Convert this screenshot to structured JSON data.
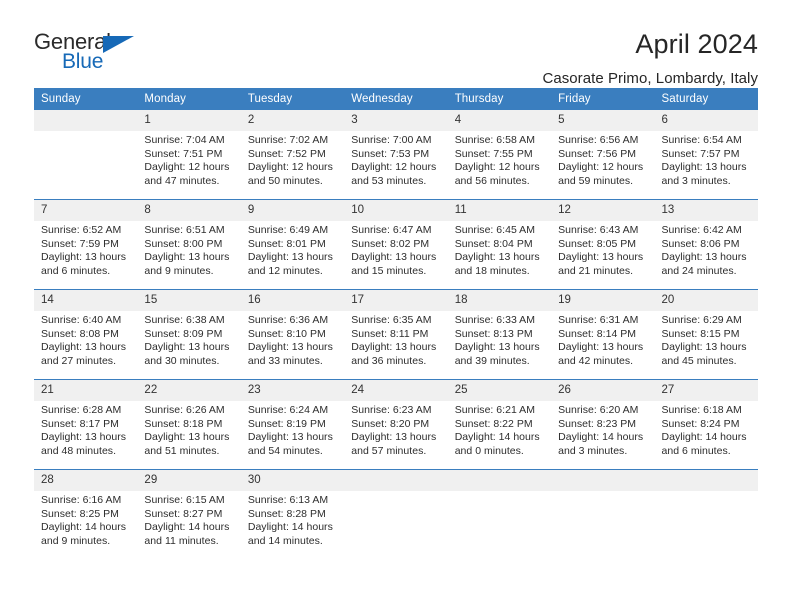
{
  "brand": {
    "word_one": "General",
    "word_two": "Blue",
    "accent_color": "#1669b7",
    "triangle_icon": "triangle-icon"
  },
  "header": {
    "title": "April 2024",
    "subtitle": "Casorate Primo, Lombardy, Italy"
  },
  "calendar": {
    "header_color": "#3a7ebf",
    "day_band_color": "#f0f0f0",
    "weekdays": [
      "Sunday",
      "Monday",
      "Tuesday",
      "Wednesday",
      "Thursday",
      "Friday",
      "Saturday"
    ],
    "weeks": [
      [
        {
          "day": ""
        },
        {
          "day": "1",
          "sunrise": "Sunrise: 7:04 AM",
          "sunset": "Sunset: 7:51 PM",
          "daylight_1": "Daylight: 12 hours",
          "daylight_2": "and 47 minutes."
        },
        {
          "day": "2",
          "sunrise": "Sunrise: 7:02 AM",
          "sunset": "Sunset: 7:52 PM",
          "daylight_1": "Daylight: 12 hours",
          "daylight_2": "and 50 minutes."
        },
        {
          "day": "3",
          "sunrise": "Sunrise: 7:00 AM",
          "sunset": "Sunset: 7:53 PM",
          "daylight_1": "Daylight: 12 hours",
          "daylight_2": "and 53 minutes."
        },
        {
          "day": "4",
          "sunrise": "Sunrise: 6:58 AM",
          "sunset": "Sunset: 7:55 PM",
          "daylight_1": "Daylight: 12 hours",
          "daylight_2": "and 56 minutes."
        },
        {
          "day": "5",
          "sunrise": "Sunrise: 6:56 AM",
          "sunset": "Sunset: 7:56 PM",
          "daylight_1": "Daylight: 12 hours",
          "daylight_2": "and 59 minutes."
        },
        {
          "day": "6",
          "sunrise": "Sunrise: 6:54 AM",
          "sunset": "Sunset: 7:57 PM",
          "daylight_1": "Daylight: 13 hours",
          "daylight_2": "and 3 minutes."
        }
      ],
      [
        {
          "day": "7",
          "sunrise": "Sunrise: 6:52 AM",
          "sunset": "Sunset: 7:59 PM",
          "daylight_1": "Daylight: 13 hours",
          "daylight_2": "and 6 minutes."
        },
        {
          "day": "8",
          "sunrise": "Sunrise: 6:51 AM",
          "sunset": "Sunset: 8:00 PM",
          "daylight_1": "Daylight: 13 hours",
          "daylight_2": "and 9 minutes."
        },
        {
          "day": "9",
          "sunrise": "Sunrise: 6:49 AM",
          "sunset": "Sunset: 8:01 PM",
          "daylight_1": "Daylight: 13 hours",
          "daylight_2": "and 12 minutes."
        },
        {
          "day": "10",
          "sunrise": "Sunrise: 6:47 AM",
          "sunset": "Sunset: 8:02 PM",
          "daylight_1": "Daylight: 13 hours",
          "daylight_2": "and 15 minutes."
        },
        {
          "day": "11",
          "sunrise": "Sunrise: 6:45 AM",
          "sunset": "Sunset: 8:04 PM",
          "daylight_1": "Daylight: 13 hours",
          "daylight_2": "and 18 minutes."
        },
        {
          "day": "12",
          "sunrise": "Sunrise: 6:43 AM",
          "sunset": "Sunset: 8:05 PM",
          "daylight_1": "Daylight: 13 hours",
          "daylight_2": "and 21 minutes."
        },
        {
          "day": "13",
          "sunrise": "Sunrise: 6:42 AM",
          "sunset": "Sunset: 8:06 PM",
          "daylight_1": "Daylight: 13 hours",
          "daylight_2": "and 24 minutes."
        }
      ],
      [
        {
          "day": "14",
          "sunrise": "Sunrise: 6:40 AM",
          "sunset": "Sunset: 8:08 PM",
          "daylight_1": "Daylight: 13 hours",
          "daylight_2": "and 27 minutes."
        },
        {
          "day": "15",
          "sunrise": "Sunrise: 6:38 AM",
          "sunset": "Sunset: 8:09 PM",
          "daylight_1": "Daylight: 13 hours",
          "daylight_2": "and 30 minutes."
        },
        {
          "day": "16",
          "sunrise": "Sunrise: 6:36 AM",
          "sunset": "Sunset: 8:10 PM",
          "daylight_1": "Daylight: 13 hours",
          "daylight_2": "and 33 minutes."
        },
        {
          "day": "17",
          "sunrise": "Sunrise: 6:35 AM",
          "sunset": "Sunset: 8:11 PM",
          "daylight_1": "Daylight: 13 hours",
          "daylight_2": "and 36 minutes."
        },
        {
          "day": "18",
          "sunrise": "Sunrise: 6:33 AM",
          "sunset": "Sunset: 8:13 PM",
          "daylight_1": "Daylight: 13 hours",
          "daylight_2": "and 39 minutes."
        },
        {
          "day": "19",
          "sunrise": "Sunrise: 6:31 AM",
          "sunset": "Sunset: 8:14 PM",
          "daylight_1": "Daylight: 13 hours",
          "daylight_2": "and 42 minutes."
        },
        {
          "day": "20",
          "sunrise": "Sunrise: 6:29 AM",
          "sunset": "Sunset: 8:15 PM",
          "daylight_1": "Daylight: 13 hours",
          "daylight_2": "and 45 minutes."
        }
      ],
      [
        {
          "day": "21",
          "sunrise": "Sunrise: 6:28 AM",
          "sunset": "Sunset: 8:17 PM",
          "daylight_1": "Daylight: 13 hours",
          "daylight_2": "and 48 minutes."
        },
        {
          "day": "22",
          "sunrise": "Sunrise: 6:26 AM",
          "sunset": "Sunset: 8:18 PM",
          "daylight_1": "Daylight: 13 hours",
          "daylight_2": "and 51 minutes."
        },
        {
          "day": "23",
          "sunrise": "Sunrise: 6:24 AM",
          "sunset": "Sunset: 8:19 PM",
          "daylight_1": "Daylight: 13 hours",
          "daylight_2": "and 54 minutes."
        },
        {
          "day": "24",
          "sunrise": "Sunrise: 6:23 AM",
          "sunset": "Sunset: 8:20 PM",
          "daylight_1": "Daylight: 13 hours",
          "daylight_2": "and 57 minutes."
        },
        {
          "day": "25",
          "sunrise": "Sunrise: 6:21 AM",
          "sunset": "Sunset: 8:22 PM",
          "daylight_1": "Daylight: 14 hours",
          "daylight_2": "and 0 minutes."
        },
        {
          "day": "26",
          "sunrise": "Sunrise: 6:20 AM",
          "sunset": "Sunset: 8:23 PM",
          "daylight_1": "Daylight: 14 hours",
          "daylight_2": "and 3 minutes."
        },
        {
          "day": "27",
          "sunrise": "Sunrise: 6:18 AM",
          "sunset": "Sunset: 8:24 PM",
          "daylight_1": "Daylight: 14 hours",
          "daylight_2": "and 6 minutes."
        }
      ],
      [
        {
          "day": "28",
          "sunrise": "Sunrise: 6:16 AM",
          "sunset": "Sunset: 8:25 PM",
          "daylight_1": "Daylight: 14 hours",
          "daylight_2": "and 9 minutes."
        },
        {
          "day": "29",
          "sunrise": "Sunrise: 6:15 AM",
          "sunset": "Sunset: 8:27 PM",
          "daylight_1": "Daylight: 14 hours",
          "daylight_2": "and 11 minutes."
        },
        {
          "day": "30",
          "sunrise": "Sunrise: 6:13 AM",
          "sunset": "Sunset: 8:28 PM",
          "daylight_1": "Daylight: 14 hours",
          "daylight_2": "and 14 minutes."
        },
        {
          "day": ""
        },
        {
          "day": ""
        },
        {
          "day": ""
        },
        {
          "day": ""
        }
      ]
    ]
  }
}
